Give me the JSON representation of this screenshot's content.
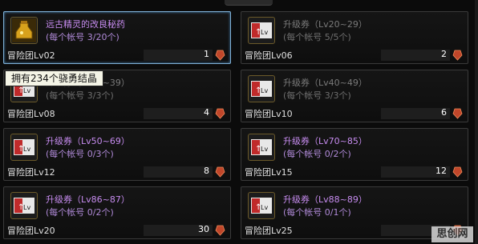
{
  "tooltip": "拥有234个骁勇结晶",
  "watermark": "思创网",
  "items": [
    {
      "name": "远古精灵的改良秘药",
      "limit": "(每个帐号 3/20个)",
      "requirement": "冒险团Lv02",
      "count": "1",
      "style": "purple",
      "icon": "potion-icon",
      "selected": true
    },
    {
      "name": "升级券（Lv20~29）",
      "limit": "(每个帐号 5/5个)",
      "requirement": "冒险团Lv06",
      "count": "2",
      "style": "gray",
      "icon": "level-ticket-icon",
      "selected": false
    },
    {
      "name": "升级券（Lv30~39）",
      "limit": "(每个帐号 3/3个)",
      "requirement": "冒险团Lv08",
      "count": "4",
      "style": "gray",
      "icon": "level-ticket-icon",
      "selected": false
    },
    {
      "name": "升级券（Lv40~49）",
      "limit": "(每个帐号 3/3个)",
      "requirement": "冒险团Lv10",
      "count": "6",
      "style": "gray",
      "icon": "level-ticket-icon",
      "selected": false
    },
    {
      "name": "升级券（Lv50~69）",
      "limit": "(每个帐号 0/3个)",
      "requirement": "冒险团Lv12",
      "count": "8",
      "style": "purple",
      "icon": "level-ticket-icon",
      "selected": false
    },
    {
      "name": "升级券（Lv70~85）",
      "limit": "(每个帐号 0/2个)",
      "requirement": "冒险团Lv15",
      "count": "12",
      "style": "purple",
      "icon": "level-ticket-icon",
      "selected": false
    },
    {
      "name": "升级券（Lv86~87）",
      "limit": "(每个帐号 0/2个)",
      "requirement": "冒险团Lv20",
      "count": "30",
      "style": "purple",
      "icon": "level-ticket-icon",
      "selected": false
    },
    {
      "name": "升级券（Lv88~89）",
      "limit": "(每个帐号 0/1个)",
      "requirement": "冒险团Lv25",
      "count": "",
      "style": "purple",
      "icon": "level-ticket-icon",
      "selected": false
    }
  ],
  "colors": {
    "selected_border": "#7fb0d6",
    "purple_text": "#c78cf0",
    "gray_text": "#7a7a7a"
  }
}
